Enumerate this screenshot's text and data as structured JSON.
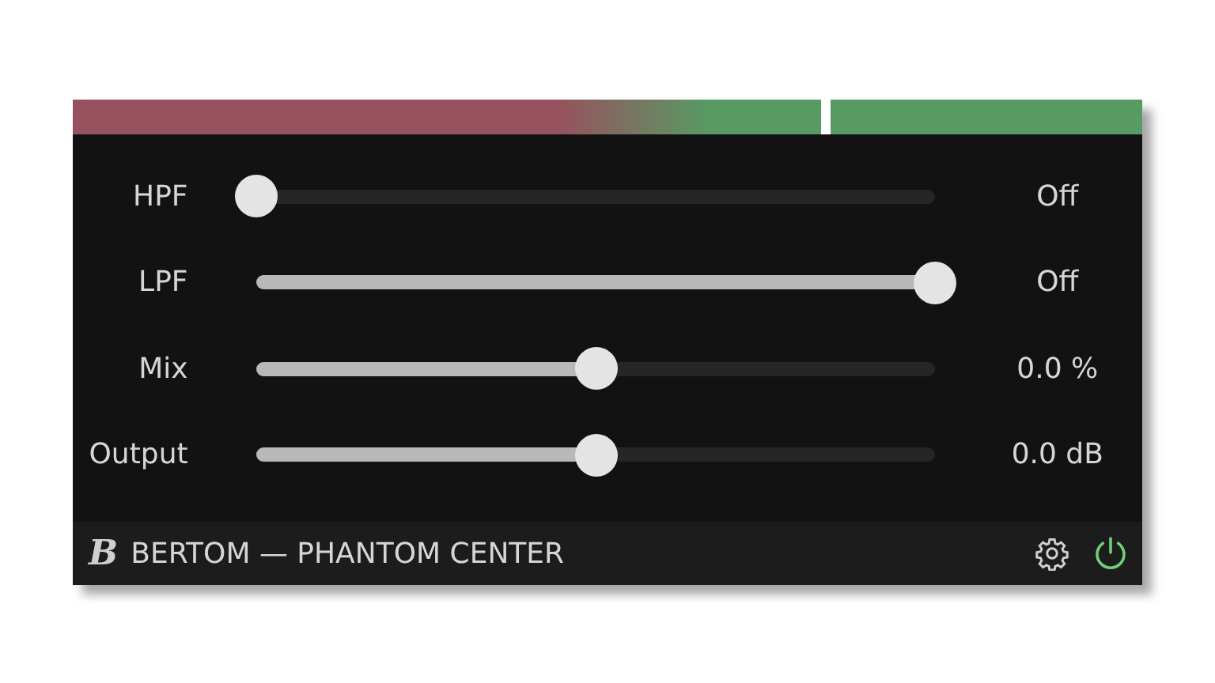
{
  "meter": {
    "level": 0.7
  },
  "controls": [
    {
      "label": "HPF",
      "level": 0,
      "reading": "Off"
    },
    {
      "label": "LPF",
      "level": 1,
      "reading": "Off"
    },
    {
      "label": "Mix",
      "level": 0.5,
      "reading": "0.0 %"
    },
    {
      "label": "Output",
      "level": 0.5,
      "reading": "0.0 dB"
    }
  ],
  "footer": {
    "logo": "B",
    "title": "BERTOM — PHANTOM CENTER",
    "power": {
      "on": true
    }
  }
}
